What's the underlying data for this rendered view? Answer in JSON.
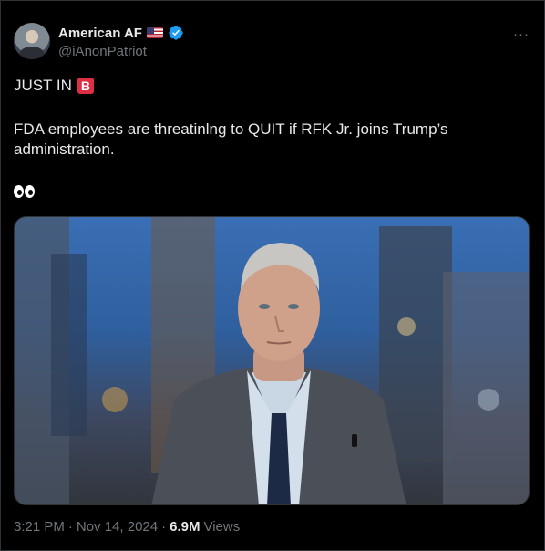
{
  "author": {
    "display_name": "American AF",
    "handle": "@iAnonPatriot",
    "verified": true,
    "flag_icon": "us-flag-icon"
  },
  "menu": {
    "more_label": "···"
  },
  "post": {
    "line1_text": "JUST IN",
    "line1_emoji": "B",
    "paragraph": "FDA employees are threatinlng to QUIT if RFK Jr. joins Trump’s administration.",
    "emoji_icon": "eyes-emoji-icon"
  },
  "media": {
    "description_icon": "tv-studio-photo"
  },
  "meta": {
    "time": "3:21 PM",
    "separator1": "·",
    "date": "Nov 14, 2024",
    "separator2": "·",
    "views_count": "6.9M",
    "views_label": "Views"
  },
  "colors": {
    "background": "#000000",
    "text": "#e7e9ea",
    "muted": "#71767b",
    "verified_blue": "#1d9bf0",
    "border": "#2f3336"
  }
}
